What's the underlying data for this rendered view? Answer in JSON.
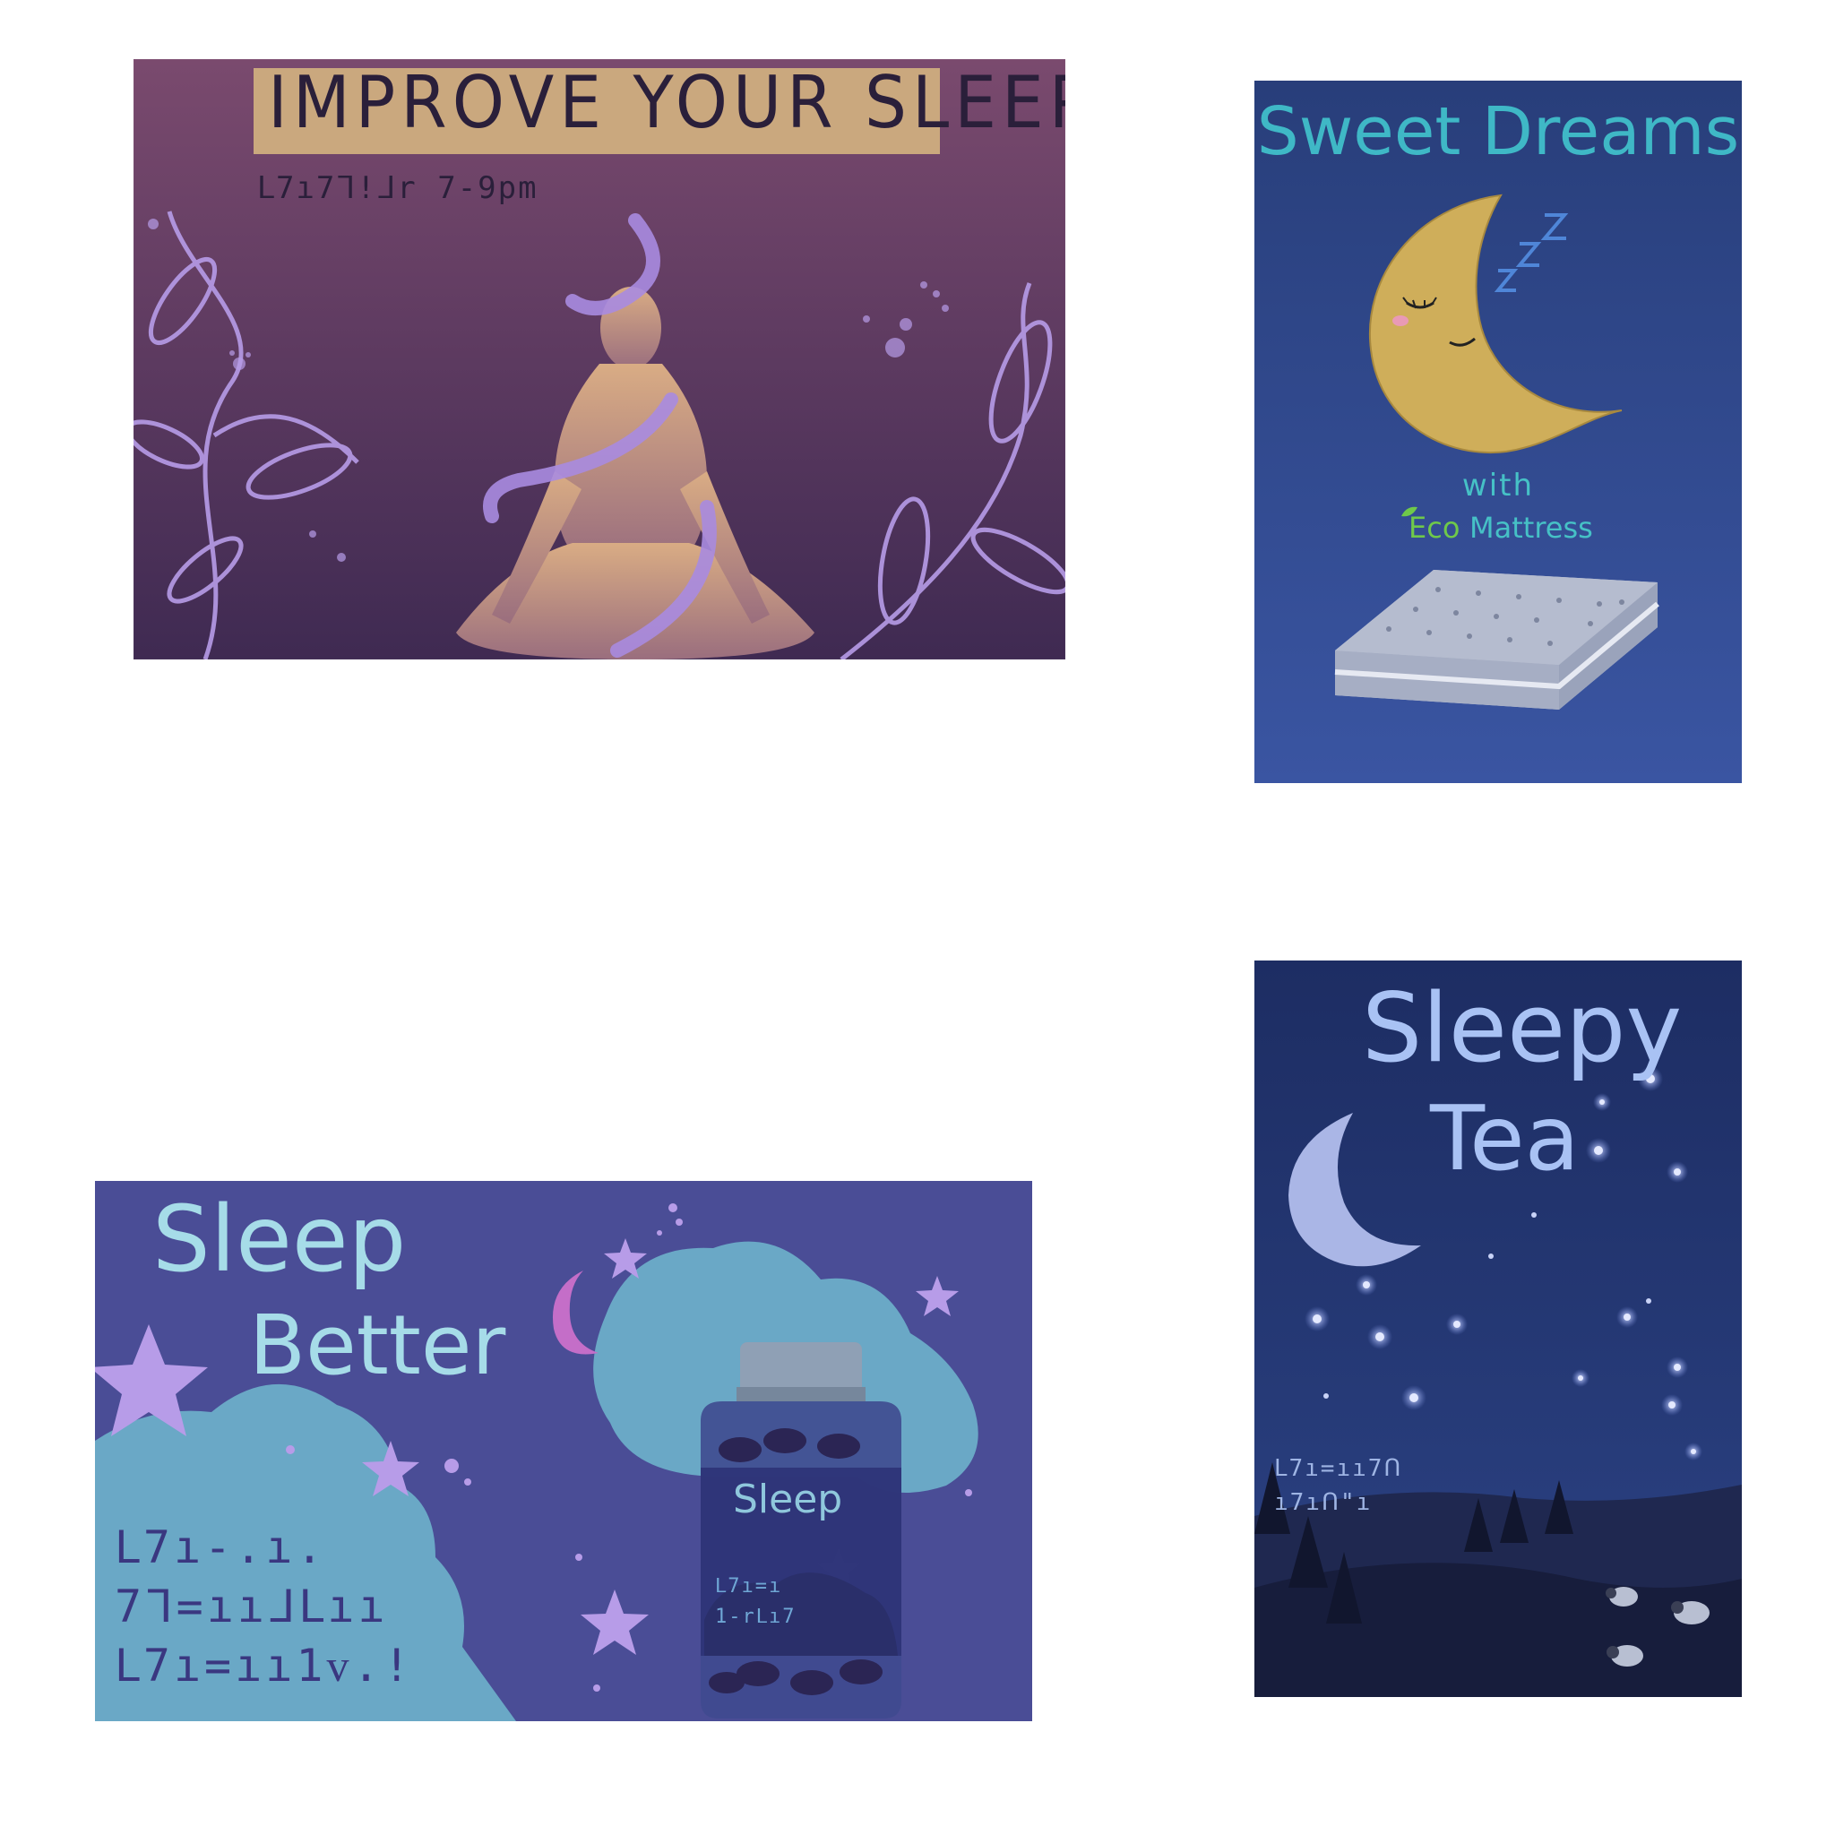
{
  "cards": {
    "improve": {
      "title": "IMPROVE YOUR SLEEP",
      "subtitle": "ᒪ7ı7ᒣ!ᒧr 7-9pm"
    },
    "sweet": {
      "title": "Sweet Dreams",
      "with_label": "with",
      "eco_label": "Eco",
      "mattress_label": "Mattress"
    },
    "better": {
      "title_line1": "Sleep",
      "title_line2": "Better",
      "scribble_lines": [
        "ᒪ7ı-.ı.",
        "7ᒣ=ııᒧᒪıı",
        "ᒪ7ı=ıı1ᴠ.!"
      ],
      "jar_label": "Sleep",
      "jar_scribble_lines": [
        "ᒪ7ı=ı",
        "1-rᒪı7"
      ]
    },
    "tea": {
      "title_line1": "Sleepy",
      "title_line2": "Tea",
      "scribble_lines": [
        "ᒪ7ı=ıı7ᑎ",
        "ı7ıᑎ\"ı"
      ]
    }
  },
  "colors": {
    "improve_bg_top": "#7a4a6e",
    "improve_bg_bottom": "#3f2a52",
    "sweet_bg": "#2e4582",
    "better_bg": "#4a4d96",
    "tea_bg": "#22356e",
    "accent_purple": "#b79ce8",
    "moon_gold": "#cfae5a",
    "cloud_teal": "#6aa8c6"
  }
}
